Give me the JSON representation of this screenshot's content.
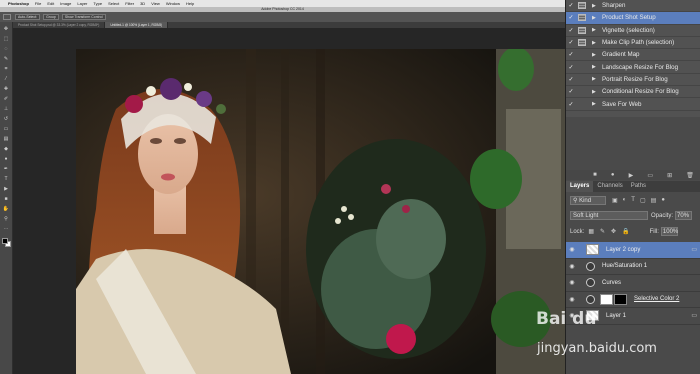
{
  "menubar": {
    "apple": "",
    "app_name": "Photoshop",
    "items": [
      "File",
      "Edit",
      "Image",
      "Layer",
      "Type",
      "Select",
      "Filter",
      "3D",
      "View",
      "Window",
      "Help"
    ]
  },
  "window_title": "Adobe Photoshop CC 2014",
  "optionsbar": {
    "auto_select": "Auto-Select:",
    "group": "Group",
    "show_transform": "Show Transform Control"
  },
  "doc_tabs": [
    {
      "label": "Product Shot Setup.psd @ 33.3% (Layer 2 copy, RGB/8*)"
    },
    {
      "label": "Untitled-1 @ 100% (Layer 1, RGB/8)"
    }
  ],
  "actions": [
    {
      "check": "✓",
      "dialog": true,
      "label": "Sharpen",
      "selected": false
    },
    {
      "check": "✓",
      "dialog": true,
      "label": "Product Shot Setup",
      "selected": true
    },
    {
      "check": "✓",
      "dialog": true,
      "label": "Vignette (selection)",
      "selected": false
    },
    {
      "check": "✓",
      "dialog": true,
      "label": "Make Clip Path (selection)",
      "selected": false
    },
    {
      "check": "✓",
      "dialog": false,
      "label": "Gradient Map",
      "selected": false
    },
    {
      "check": "✓",
      "dialog": false,
      "label": "Landscape Resize For Blog",
      "selected": false
    },
    {
      "check": "✓",
      "dialog": false,
      "label": "Portrait Resize For Blog",
      "selected": false
    },
    {
      "check": "✓",
      "dialog": false,
      "label": "Conditional Resize For Blog",
      "selected": false
    },
    {
      "check": "✓",
      "dialog": false,
      "label": "Save For Web",
      "selected": false
    }
  ],
  "layers_panel": {
    "tabs": [
      "Layers",
      "Channels",
      "Paths"
    ],
    "kind": "Kind",
    "blend_mode": "Soft Light",
    "opacity_label": "Opacity:",
    "opacity": "70%",
    "lock_label": "Lock:",
    "fill_label": "Fill:",
    "fill": "100%",
    "layers": [
      {
        "name": "Layer 2 copy",
        "type": "pixel",
        "selected": true
      },
      {
        "name": "Hue/Saturation 1",
        "type": "adjustment",
        "selected": false
      },
      {
        "name": "Curves",
        "type": "adjustment",
        "selected": false
      },
      {
        "name": "Selective Color 2",
        "type": "adjustment-mask",
        "selected": false
      },
      {
        "name": "Layer 1",
        "type": "pixel",
        "selected": false
      }
    ]
  },
  "watermark": {
    "logo": "Bai du",
    "url": "jingyan.baidu.com"
  },
  "colors": {
    "selection": "#5b7ebd",
    "panel_bg": "#4a4a4a",
    "workspace": "#262626"
  }
}
